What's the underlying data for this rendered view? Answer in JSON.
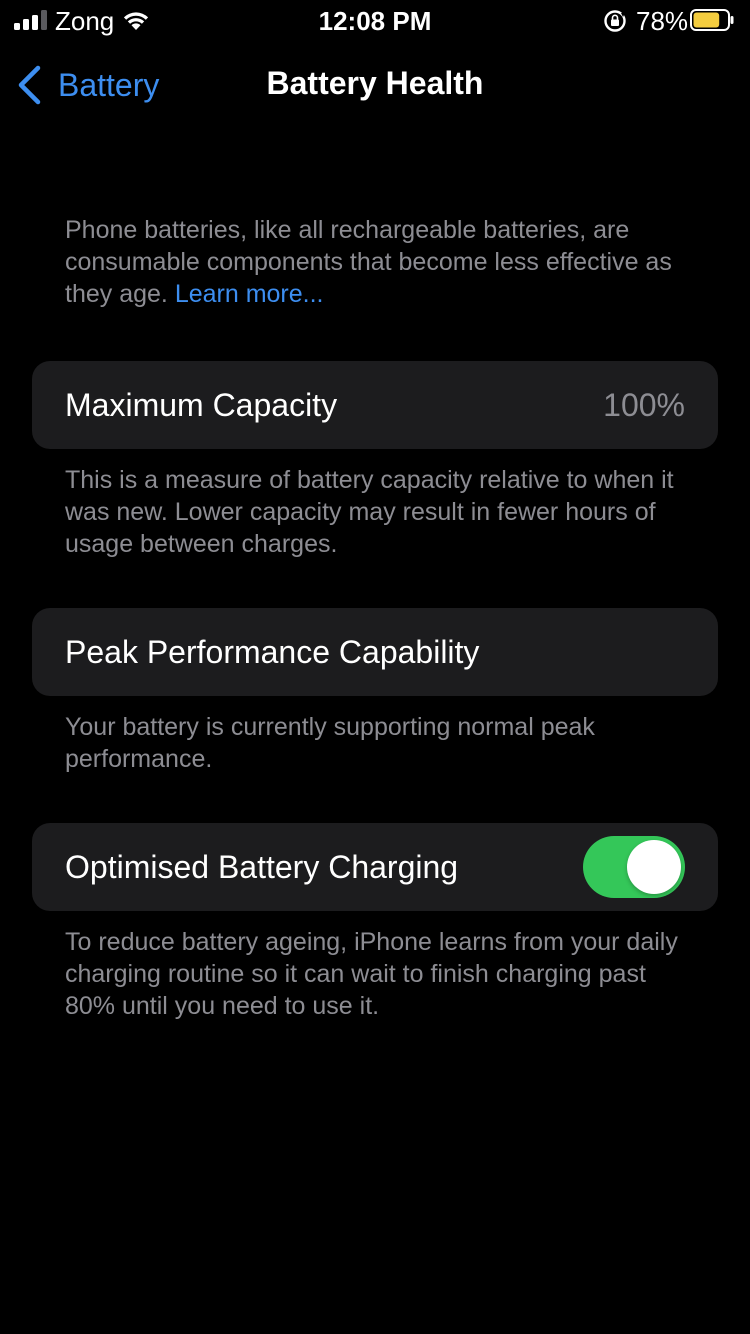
{
  "status_bar": {
    "carrier": "Zong",
    "time": "12:08 PM",
    "battery_percent": "78%",
    "battery_level": 0.78,
    "signal_bars_active": 3,
    "signal_bars_total": 4,
    "icons": [
      "signal-icon",
      "wifi-icon",
      "rotation-lock-icon",
      "battery-icon"
    ],
    "battery_color": "#f4cd3f"
  },
  "nav": {
    "back_label": "Battery",
    "title": "Battery Health",
    "accent_color": "#3d8ef0"
  },
  "intro": {
    "text": "Phone batteries, like all rechargeable batteries, are consumable components that become less effective as they age.",
    "link_label": "Learn more..."
  },
  "maximum_capacity": {
    "label": "Maximum Capacity",
    "value": "100%",
    "footnote": "This is a measure of battery capacity relative to when it was new. Lower capacity may result in fewer hours of usage between charges."
  },
  "peak_performance": {
    "label": "Peak Performance Capability",
    "footnote": "Your battery is currently supporting normal peak performance."
  },
  "optimised_charging": {
    "label": "Optimised Battery Charging",
    "enabled": true,
    "toggle_color": "#34c759",
    "footnote": "To reduce battery ageing, iPhone learns from your daily charging routine so it can wait to finish charging past 80% until you need to use it."
  }
}
